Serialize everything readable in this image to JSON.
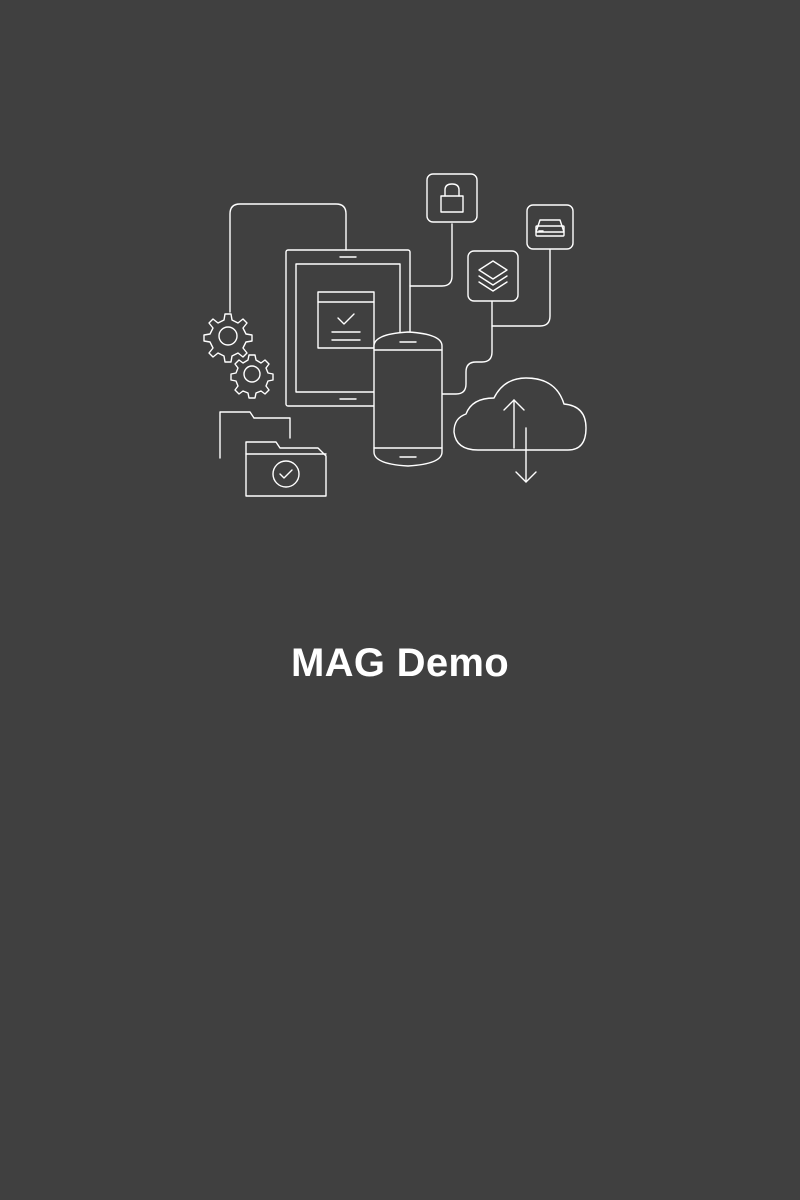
{
  "splash": {
    "app_title": "MAG Demo",
    "illustration_icons": [
      "gear-icon",
      "tablet-icon",
      "smartphone-icon",
      "lock-icon",
      "layers-icon",
      "drive-icon",
      "cloud-sync-icon",
      "folder-icon",
      "folder-check-icon"
    ]
  },
  "colors": {
    "background": "#404040",
    "foreground": "#ffffff"
  }
}
